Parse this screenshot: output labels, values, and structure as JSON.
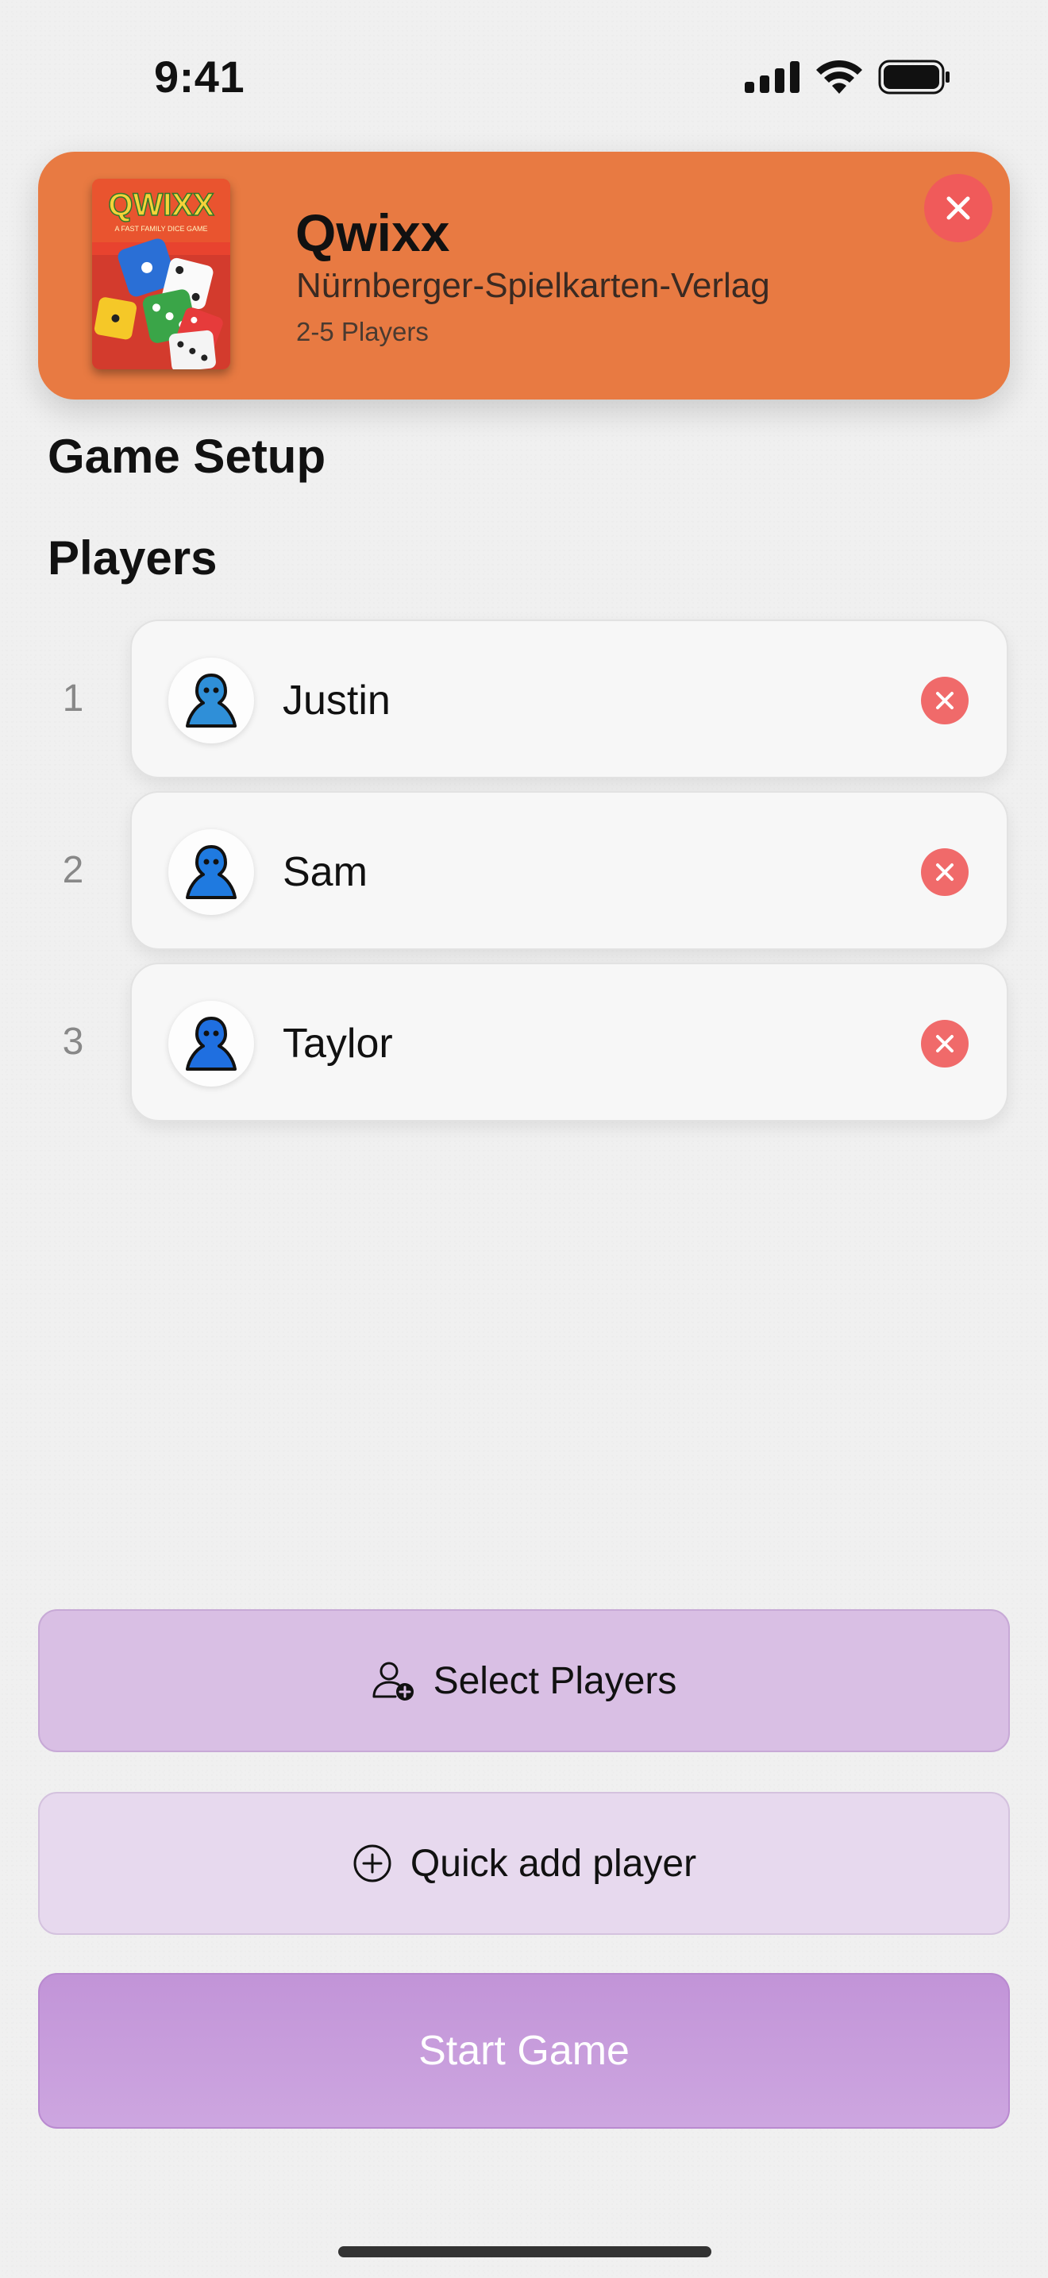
{
  "status_bar": {
    "time": "9:41"
  },
  "game": {
    "title": "Qwixx",
    "publisher": "Nürnberger-Spielkarten-Verlag",
    "players": "2-5 Players",
    "box_title": "QWIXX",
    "box_tagline": "A FAST FAMILY DICE GAME",
    "accent": "#e87a42"
  },
  "headings": {
    "setup": "Game Setup",
    "players": "Players"
  },
  "players": [
    {
      "index": "1",
      "name": "Justin",
      "avatar_color": "#2f8fd8"
    },
    {
      "index": "2",
      "name": "Sam",
      "avatar_color": "#1f7ae0"
    },
    {
      "index": "3",
      "name": "Taylor",
      "avatar_color": "#1f6fe0"
    }
  ],
  "buttons": {
    "select_players": "Select Players",
    "quick_add": "Quick add player",
    "start_game": "Start Game"
  },
  "icons": {
    "close": "xmark-circle-icon",
    "avatar": "meeple-icon",
    "select": "person-plus-icon",
    "quick_add": "plus-circle-icon"
  }
}
